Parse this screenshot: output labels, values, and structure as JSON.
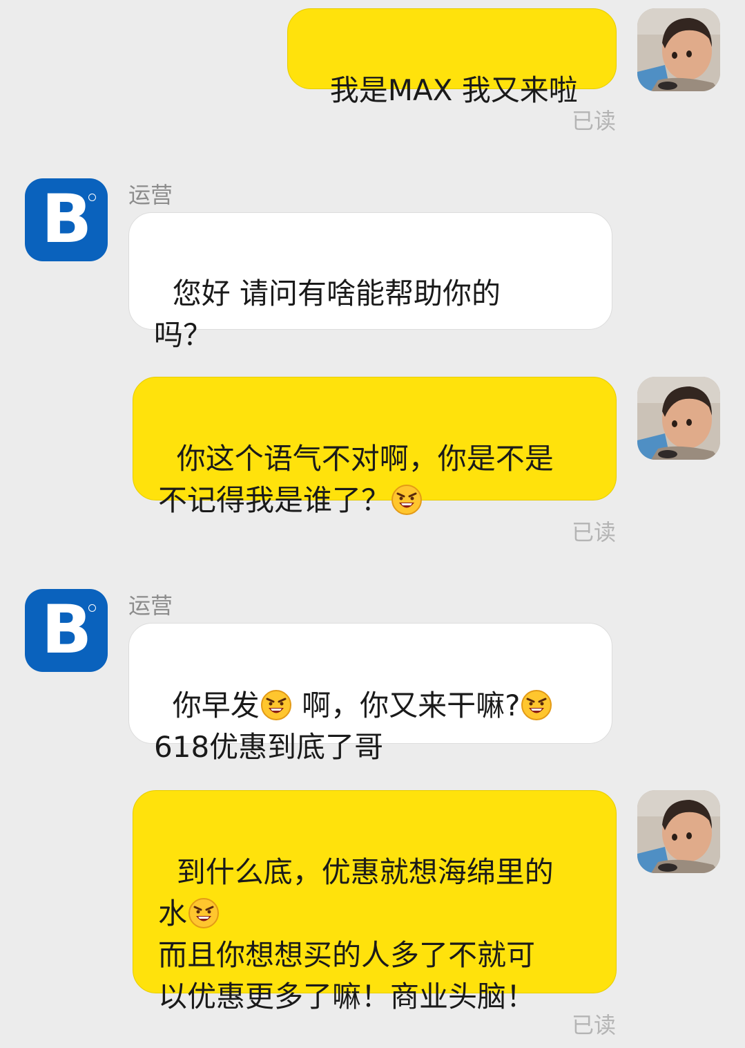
{
  "messages": [
    {
      "side": "me",
      "segments": [
        {
          "t": "我是MAX 我又来啦"
        }
      ],
      "status": "已读"
    },
    {
      "side": "op",
      "sender": "运营",
      "segments": [
        {
          "t": "您好 请问有啥能帮助你的\n吗？"
        }
      ]
    },
    {
      "side": "me",
      "segments": [
        {
          "t": "你这个语气不对啊，你是不是\n不记得我是谁了？"
        },
        {
          "emoji": "laughing-angry-emoji"
        }
      ],
      "status": "已读"
    },
    {
      "side": "op",
      "sender": "运营",
      "segments": [
        {
          "t": "你早发"
        },
        {
          "emoji": "laughing-angry-emoji"
        },
        {
          "t": " 啊，你又来干嘛?"
        },
        {
          "emoji": "laughing-angry-emoji"
        },
        {
          "t": "\n618优惠到底了哥"
        }
      ]
    },
    {
      "side": "me",
      "segments": [
        {
          "t": "到什么底，优惠就想海绵里的\n水"
        },
        {
          "emoji": "laughing-angry-emoji"
        },
        {
          "t": "\n而且你想想买的人多了不就可\n以优惠更多了嘛！商业头脑！"
        }
      ],
      "status": "已读"
    }
  ],
  "colors": {
    "background": "#ececec",
    "my_bubble": "#ffe20c",
    "their_bubble": "#ffffff",
    "brand_blue": "#0a62bd",
    "read_status": "#b4b4b4"
  }
}
